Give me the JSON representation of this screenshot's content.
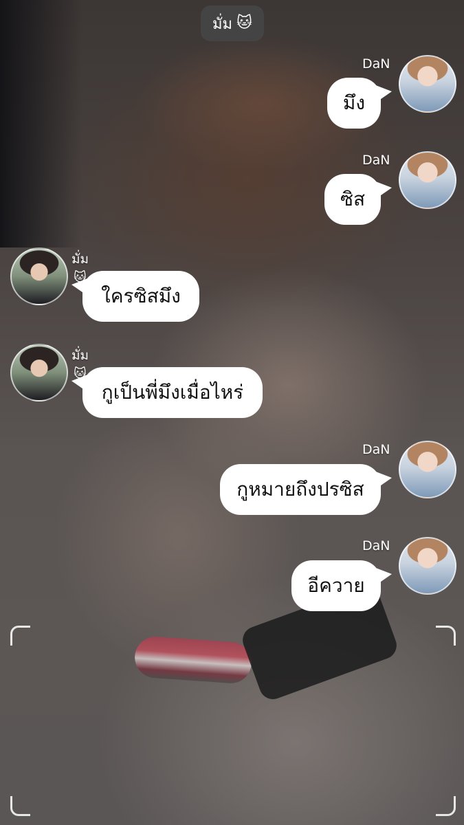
{
  "header": {
    "title": "มั่ม",
    "title_icon": "🐱"
  },
  "messages": [
    {
      "sender": "DaN",
      "text": "มึง",
      "avatar": "dan-avatar"
    },
    {
      "sender": "DaN",
      "text": "ซิส",
      "avatar": "dan-avatar"
    },
    {
      "sender": "มั่ม",
      "sender_icon": "🐱",
      "text": "ใครซิสมึง",
      "avatar": "mum-avatar"
    },
    {
      "sender": "มั่ม",
      "sender_icon": "🐱",
      "text": "กูเป็นพี่มึงเมื่อไหร่",
      "avatar": "mum-avatar"
    },
    {
      "sender": "DaN",
      "text": "กูหมายถึงปรซิส",
      "avatar": "dan-avatar"
    },
    {
      "sender": "DaN",
      "text": "อีควาย",
      "avatar": "dan-avatar"
    }
  ]
}
